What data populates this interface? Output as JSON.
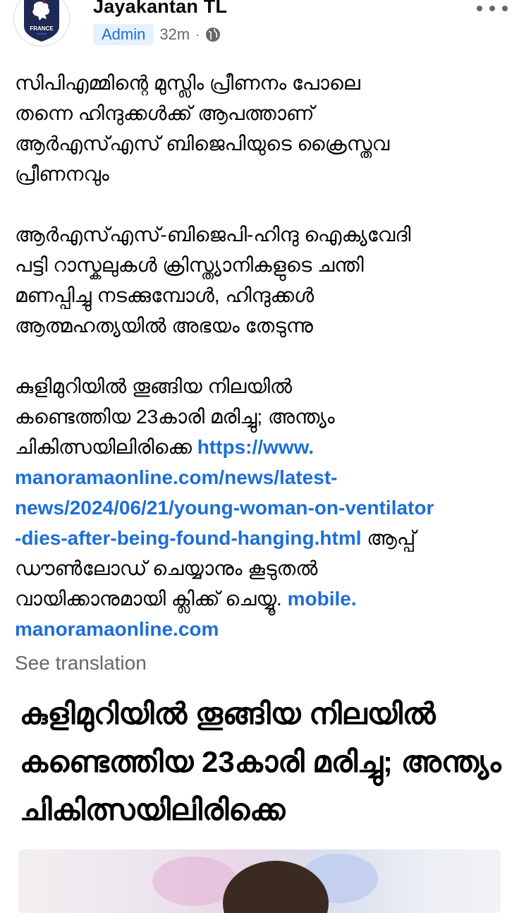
{
  "post": {
    "author": "Jayakantan TL",
    "role_badge": "Admin",
    "time": "32m",
    "separator": "·",
    "privacy_icon": "globe-icon",
    "more_icon": "more-horizontal-icon",
    "avatar": {
      "brand": "FRANCE",
      "icon": "rooster-crest-icon",
      "colors": {
        "crest": "#1e2a55",
        "rooster": "#ffffff",
        "accent": "#2b4fa8"
      }
    },
    "body": {
      "paragraph1": "സിപിഎമ്മിന്റെ മുസ്ലിം പ്രീണനം പോലെ\nതന്നെ ഹിന്ദുക്കൾക്ക് ആപത്താണ്\nആർഎസ്എസ് ബിജെപിയുടെ ക്രൈസ്തവ\nപ്രീണനവും",
      "paragraph2": "ആർഎസ്എസ്-ബിജെപി-ഹിന്ദു ഐക്യവേദി\nപട്ടി റാസ്കലുകൾ ക്രിസ്ത്യാനികളുടെ ചന്തി\nമണപ്പിച്ചു നടക്കുമ്പോൾ, ഹിന്ദുക്കൾ\nആത്മഹത്യയിൽ അഭയം തേടുന്നു",
      "paragraph3_text_a": "കുളിമുറിയിൽ തൂങ്ങിയ നിലയിൽ\nകണ്ടെത്തിയ 23കാരി മരിച്ചു; അന്ത്യം\nചികിത്സയിലിരിക്കെ ",
      "paragraph3_link_a": "https://www.\nmanoramaonline.com/news/latest-\nnews/2024/06/21/young-woman-on-ventilator\n-dies-after-being-found-hanging.html",
      "paragraph3_text_b": " ആപ്പ്\nഡൗൺലോഡ് ചെയ്യാനും കൂടുതൽ\nവായിക്കാനുമായി ക്ലിക്ക് ചെയ്യൂ. ",
      "paragraph3_link_b": "mobile.\nmanoramaonline.com"
    },
    "see_translation": "See translation",
    "link_preview": {
      "title": "കുളിമുറിയിൽ തൂങ്ങിയ നിലയിൽ കണ്ടെത്തിയ 23കാരി മരിച്ചു; അന്ത്യം ചികിത്സയിലിരിക്കെ"
    }
  }
}
